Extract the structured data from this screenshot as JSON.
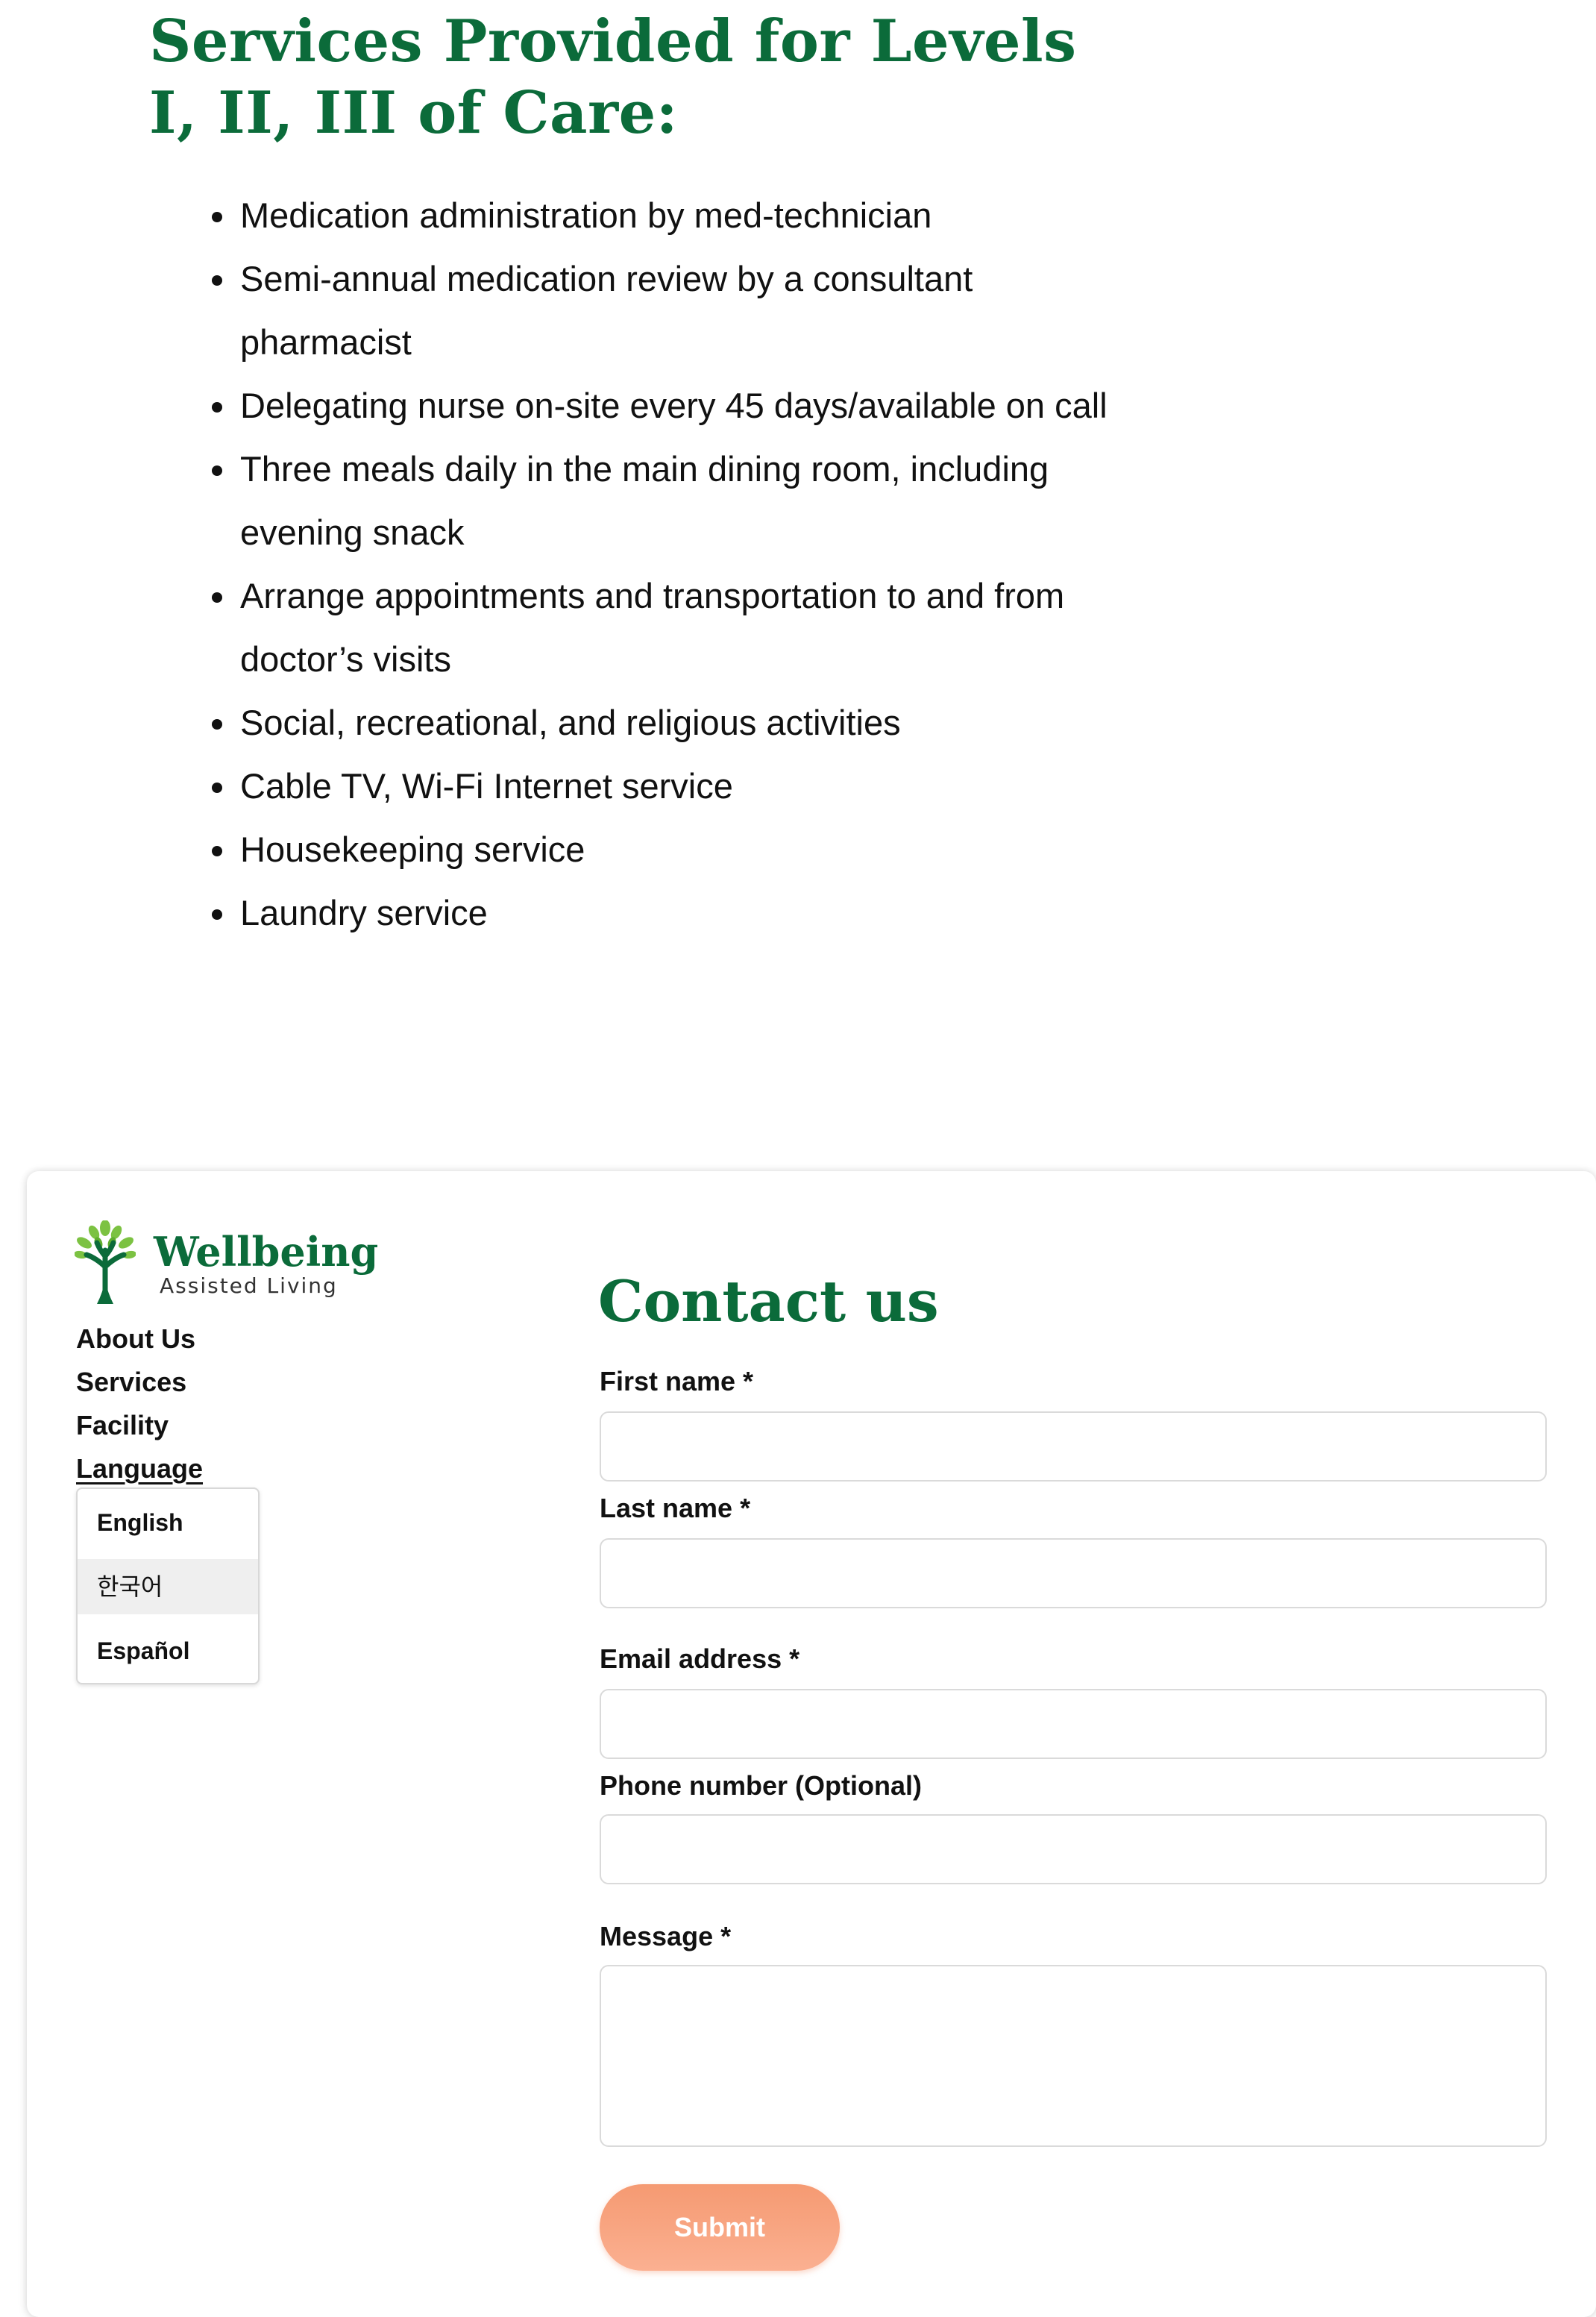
{
  "services": {
    "title": "Services Provided for Levels I, II, III of Care:",
    "items": [
      "Medication administration by med-technician",
      "Semi-annual medication review by a consultant pharmacist",
      "Delegating nurse on-site every 45 days/available on call",
      "Three meals daily in the main dining room, including evening snack",
      "Arrange appointments and transportation to and from doctor’s visits",
      "Social, recreational, and religious activities",
      "Cable TV, Wi-Fi Internet service",
      "Housekeeping service",
      "Laundry service"
    ]
  },
  "footer": {
    "logo": {
      "name": "Wellbeing",
      "tagline": "Assisted Living",
      "icon": "tree-icon"
    },
    "nav": {
      "about": "About Us",
      "services": "Services",
      "facility": "Facility",
      "language": "Language"
    },
    "language_menu": {
      "options": [
        "English",
        "한국어",
        "Español"
      ],
      "highlighted_index": 1
    }
  },
  "contact": {
    "title": "Contact us",
    "first_name_label": "First name *",
    "last_name_label": "Last name *",
    "email_label": "Email address *",
    "phone_label": "Phone number (Optional)",
    "message_label": "Message *",
    "first_name_value": "",
    "last_name_value": "",
    "email_value": "",
    "phone_value": "",
    "message_value": "",
    "submit_label": "Submit"
  },
  "colors": {
    "brand_green": "#0b6b3a",
    "leaf_green": "#7cc242",
    "submit_orange": "#f59a72"
  }
}
